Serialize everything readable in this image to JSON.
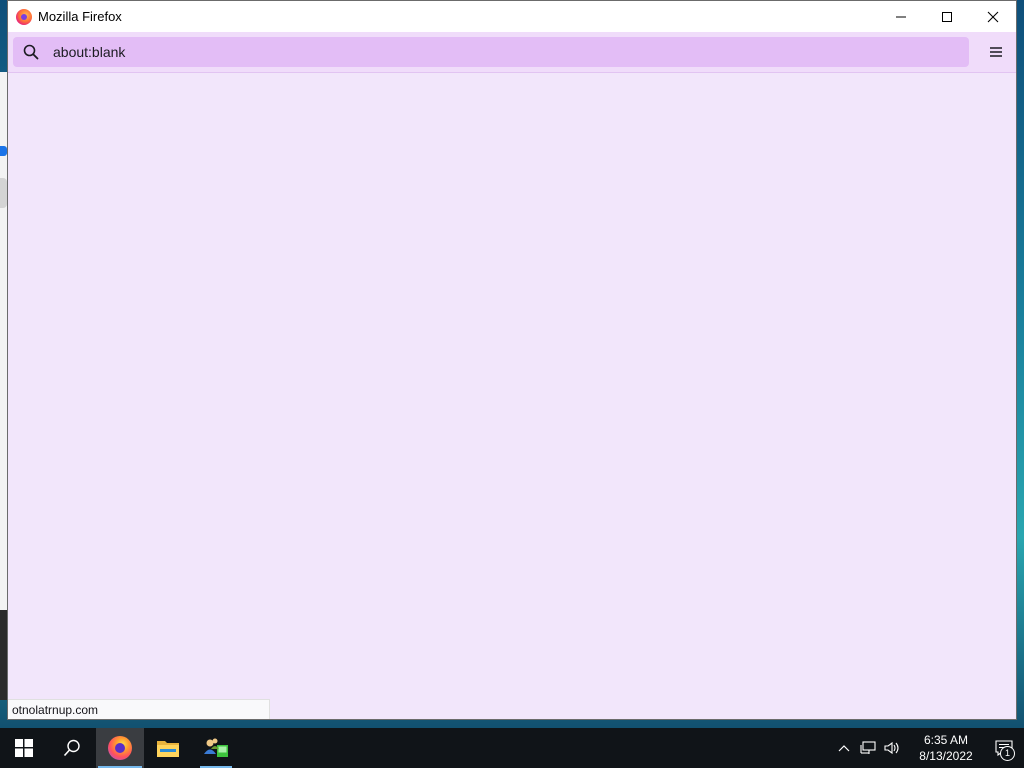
{
  "window": {
    "title": "Mozilla Firefox",
    "icon": "firefox-icon"
  },
  "window_controls": {
    "minimize": "minimize-icon",
    "maximize": "maximize-icon",
    "close": "close-icon"
  },
  "urlbar": {
    "value": "about:blank",
    "icon": "search-icon"
  },
  "toolbar": {
    "menu_icon": "hamburger-menu-icon"
  },
  "status": {
    "link_text": "otnolatrnup.com"
  },
  "taskbar": {
    "apps": [
      {
        "name": "Firefox",
        "icon": "firefox-icon",
        "state": "active"
      },
      {
        "name": "File Explorer",
        "icon": "folder-icon",
        "state": "normal"
      },
      {
        "name": "Network app",
        "icon": "network-users-icon",
        "state": "running"
      }
    ],
    "tray": {
      "chevron": "chevron-up-icon",
      "network": "network-icon",
      "volume": "volume-icon"
    },
    "clock": {
      "time": "6:35 AM",
      "date": "8/13/2022"
    },
    "notifications": {
      "count": "1"
    }
  },
  "colors": {
    "content_bg": "#f2e6fb",
    "urlbar_bg": "#e3bdf6",
    "taskbar_bg": "#101418",
    "accent": "#76b9ed"
  }
}
